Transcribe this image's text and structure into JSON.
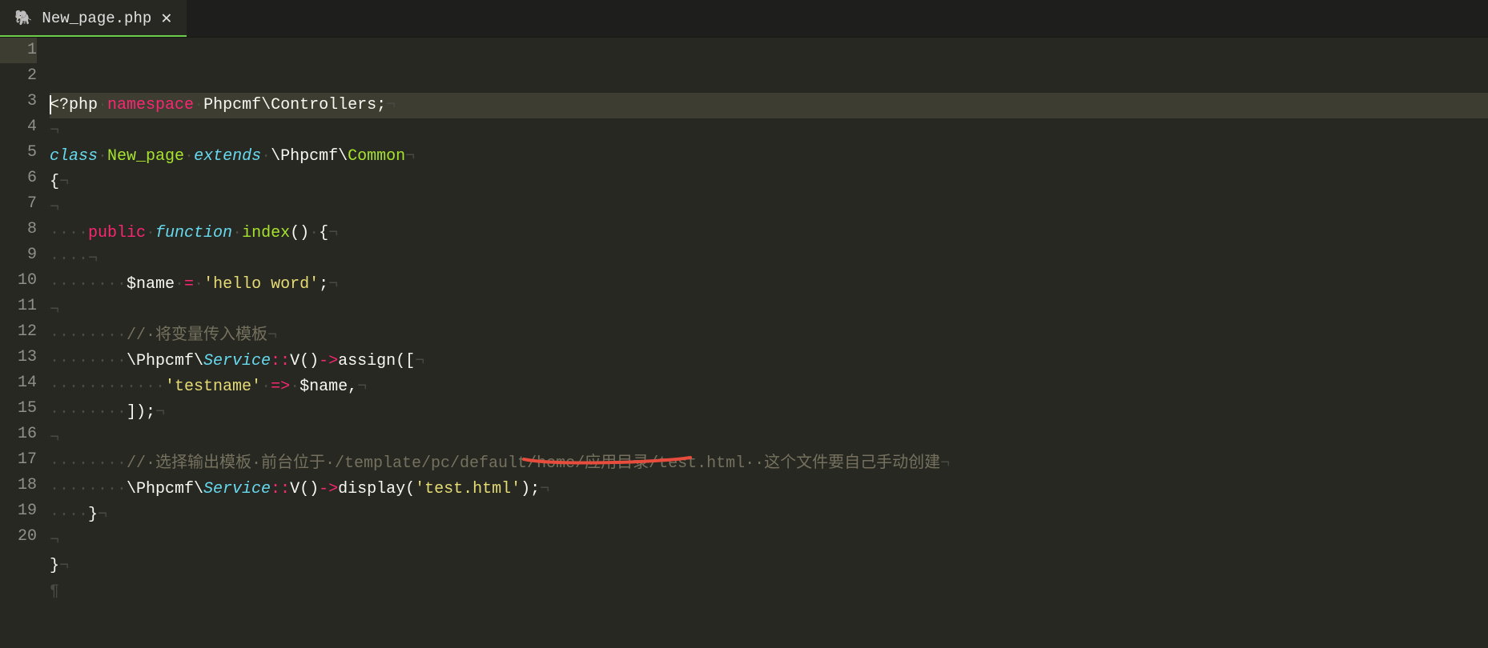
{
  "tab": {
    "title": "New_page.php",
    "icon_glyph": "🐘",
    "close_glyph": "✕"
  },
  "code": {
    "lines": [
      {
        "n": 1,
        "current": true,
        "tokens": [
          {
            "t": "caret"
          },
          {
            "t": "tag",
            "v": "<?php"
          },
          {
            "t": "ws",
            "v": "·"
          },
          {
            "t": "keyword",
            "v": "namespace"
          },
          {
            "t": "ws",
            "v": "·"
          },
          {
            "t": "punct",
            "v": "Phpcmf\\Controllers"
          },
          {
            "t": "punct",
            "v": ";"
          },
          {
            "t": "ws",
            "v": "¬"
          }
        ]
      },
      {
        "n": 2,
        "tokens": [
          {
            "t": "ws",
            "v": "¬"
          }
        ]
      },
      {
        "n": 3,
        "tokens": [
          {
            "t": "storage",
            "v": "class"
          },
          {
            "t": "ws",
            "v": "·"
          },
          {
            "t": "classname",
            "v": "New_page"
          },
          {
            "t": "ws",
            "v": "·"
          },
          {
            "t": "storage",
            "v": "extends"
          },
          {
            "t": "ws",
            "v": "·"
          },
          {
            "t": "punct",
            "v": "\\Phpcmf\\"
          },
          {
            "t": "classname",
            "v": "Common"
          },
          {
            "t": "ws",
            "v": "¬"
          }
        ]
      },
      {
        "n": 4,
        "tokens": [
          {
            "t": "punct",
            "v": "{"
          },
          {
            "t": "ws",
            "v": "¬"
          }
        ]
      },
      {
        "n": 5,
        "tokens": [
          {
            "t": "ws",
            "v": "¬"
          }
        ]
      },
      {
        "n": 6,
        "tokens": [
          {
            "t": "ws",
            "v": "····"
          },
          {
            "t": "keyword",
            "v": "public"
          },
          {
            "t": "ws",
            "v": "·"
          },
          {
            "t": "storage",
            "v": "function"
          },
          {
            "t": "ws",
            "v": "·"
          },
          {
            "t": "funcname",
            "v": "index"
          },
          {
            "t": "punct",
            "v": "()"
          },
          {
            "t": "ws",
            "v": "·"
          },
          {
            "t": "punct",
            "v": "{"
          },
          {
            "t": "ws",
            "v": "¬"
          }
        ]
      },
      {
        "n": 7,
        "tokens": [
          {
            "t": "ws",
            "v": "····¬"
          }
        ]
      },
      {
        "n": 8,
        "tokens": [
          {
            "t": "ws",
            "v": "········"
          },
          {
            "t": "var",
            "v": "$name"
          },
          {
            "t": "ws",
            "v": "·"
          },
          {
            "t": "op",
            "v": "="
          },
          {
            "t": "ws",
            "v": "·"
          },
          {
            "t": "string",
            "v": "'hello word'"
          },
          {
            "t": "punct",
            "v": ";"
          },
          {
            "t": "ws",
            "v": "¬"
          }
        ]
      },
      {
        "n": 9,
        "tokens": [
          {
            "t": "ws",
            "v": "¬"
          }
        ]
      },
      {
        "n": 10,
        "tokens": [
          {
            "t": "ws",
            "v": "········"
          },
          {
            "t": "comment",
            "v": "//·将变量传入模板"
          },
          {
            "t": "ws",
            "v": "¬"
          }
        ]
      },
      {
        "n": 11,
        "tokens": [
          {
            "t": "ws",
            "v": "········"
          },
          {
            "t": "punct",
            "v": "\\Phpcmf\\"
          },
          {
            "t": "servicecls",
            "v": "Service"
          },
          {
            "t": "op",
            "v": "::"
          },
          {
            "t": "punct",
            "v": "V()"
          },
          {
            "t": "op",
            "v": "->"
          },
          {
            "t": "punct",
            "v": "assign(["
          },
          {
            "t": "ws",
            "v": "¬"
          }
        ]
      },
      {
        "n": 12,
        "tokens": [
          {
            "t": "ws",
            "v": "············"
          },
          {
            "t": "string",
            "v": "'testname'"
          },
          {
            "t": "ws",
            "v": "·"
          },
          {
            "t": "op",
            "v": "=>"
          },
          {
            "t": "ws",
            "v": "·"
          },
          {
            "t": "var",
            "v": "$name"
          },
          {
            "t": "punct",
            "v": ","
          },
          {
            "t": "ws",
            "v": "¬"
          }
        ]
      },
      {
        "n": 13,
        "tokens": [
          {
            "t": "ws",
            "v": "········"
          },
          {
            "t": "punct",
            "v": "]);"
          },
          {
            "t": "ws",
            "v": "¬"
          }
        ]
      },
      {
        "n": 14,
        "tokens": [
          {
            "t": "ws",
            "v": "¬"
          }
        ]
      },
      {
        "n": 15,
        "tokens": [
          {
            "t": "ws",
            "v": "········"
          },
          {
            "t": "comment",
            "v": "//·选择输出模板·前台位于·/template/pc/default/home/应用目录/test.html··这个文件要自己手动创建"
          },
          {
            "t": "ws",
            "v": "¬"
          }
        ]
      },
      {
        "n": 16,
        "tokens": [
          {
            "t": "ws",
            "v": "········"
          },
          {
            "t": "punct",
            "v": "\\Phpcmf\\"
          },
          {
            "t": "servicecls",
            "v": "Service"
          },
          {
            "t": "op",
            "v": "::"
          },
          {
            "t": "punct",
            "v": "V()"
          },
          {
            "t": "op",
            "v": "->"
          },
          {
            "t": "punct",
            "v": "display("
          },
          {
            "t": "string",
            "v": "'test.html'"
          },
          {
            "t": "punct",
            "v": ");"
          },
          {
            "t": "ws",
            "v": "¬"
          }
        ]
      },
      {
        "n": 17,
        "tokens": [
          {
            "t": "ws",
            "v": "····"
          },
          {
            "t": "punct",
            "v": "}"
          },
          {
            "t": "ws",
            "v": "¬"
          }
        ]
      },
      {
        "n": 18,
        "tokens": [
          {
            "t": "ws",
            "v": "¬"
          }
        ]
      },
      {
        "n": 19,
        "tokens": [
          {
            "t": "punct",
            "v": "}"
          },
          {
            "t": "ws",
            "v": "¬"
          }
        ]
      },
      {
        "n": 20,
        "tokens": [
          {
            "t": "ws",
            "v": "¶"
          }
        ]
      }
    ]
  },
  "annotation": {
    "color": "#e74c3c"
  }
}
